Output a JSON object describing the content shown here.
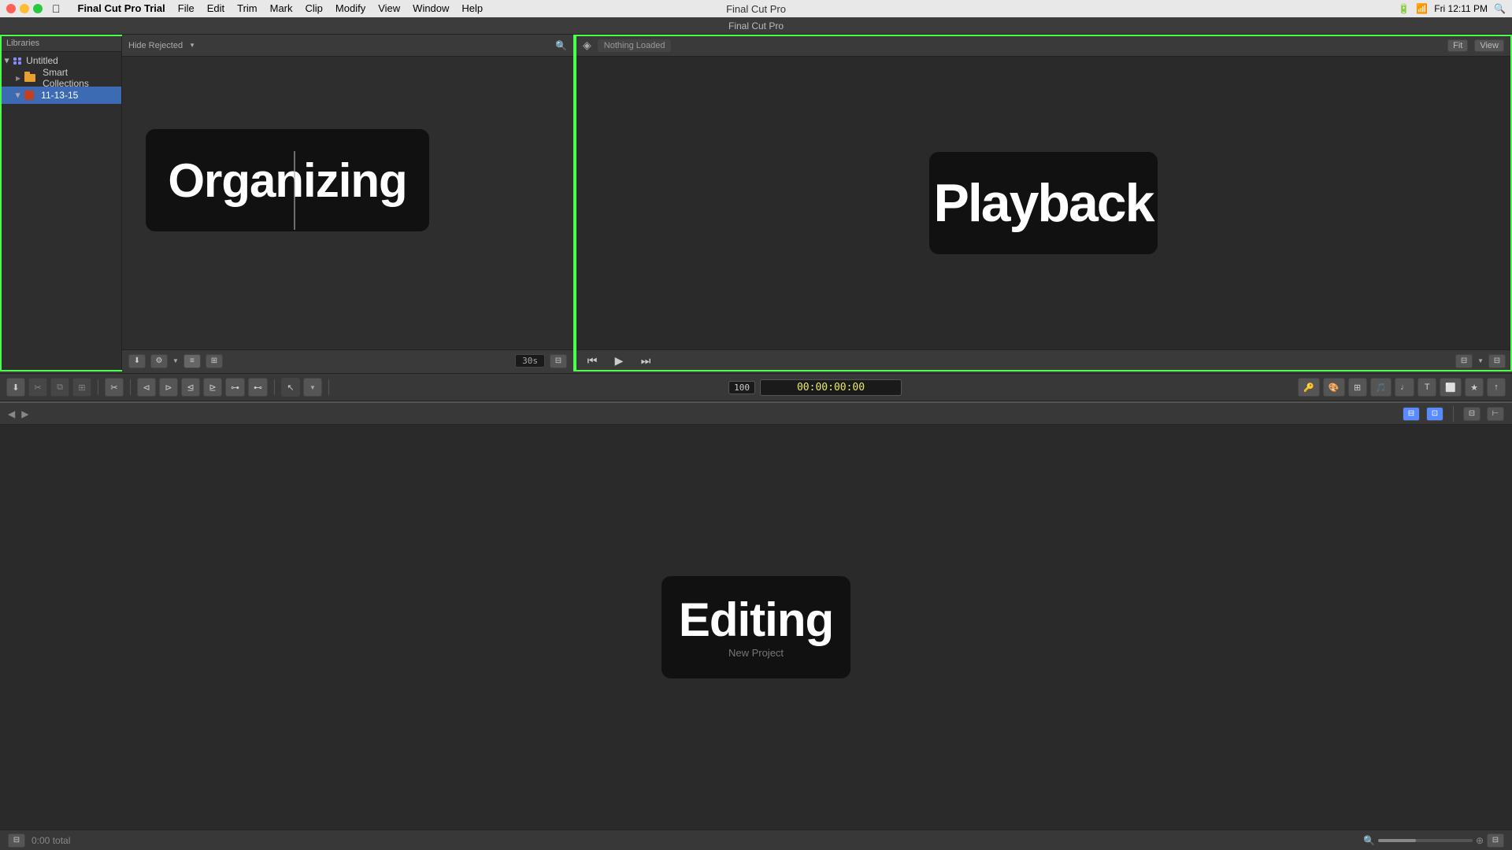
{
  "menubar": {
    "title": "Final Cut Pro",
    "app_name": "Final Cut Pro Trial",
    "menus": [
      "File",
      "Edit",
      "Trim",
      "Mark",
      "Clip",
      "Modify",
      "View",
      "Window",
      "Help"
    ],
    "window_title": "Final Cut Pro",
    "time": "Fri 12:11 PM",
    "battery": "A7"
  },
  "library": {
    "header": "Libraries",
    "items": [
      {
        "label": "Untitled",
        "type": "library",
        "expanded": true
      },
      {
        "label": "Smart Collections",
        "type": "folder",
        "expanded": false
      },
      {
        "label": "11-13-15",
        "type": "event",
        "selected": true
      }
    ]
  },
  "browser": {
    "filter": "Hide Rejected",
    "timecode": "30s",
    "organizing_label": "Organizing"
  },
  "viewer": {
    "status": "Nothing Loaded",
    "fit_label": "Fit",
    "view_label": "View",
    "playback_label": "Playback"
  },
  "toolbar": {
    "timecode": "00:00:00:00",
    "frame_value": "100",
    "tools": [
      "←",
      "→"
    ],
    "icons": [
      "⬇",
      "✂",
      "⧉",
      "⊞"
    ]
  },
  "timeline": {
    "editing_label": "Editing",
    "editing_subtitle": "New Project",
    "total": "0:00 total",
    "header_arrows": [
      "◀",
      "▶"
    ]
  },
  "status_bar": {
    "total": "0:00 total"
  }
}
